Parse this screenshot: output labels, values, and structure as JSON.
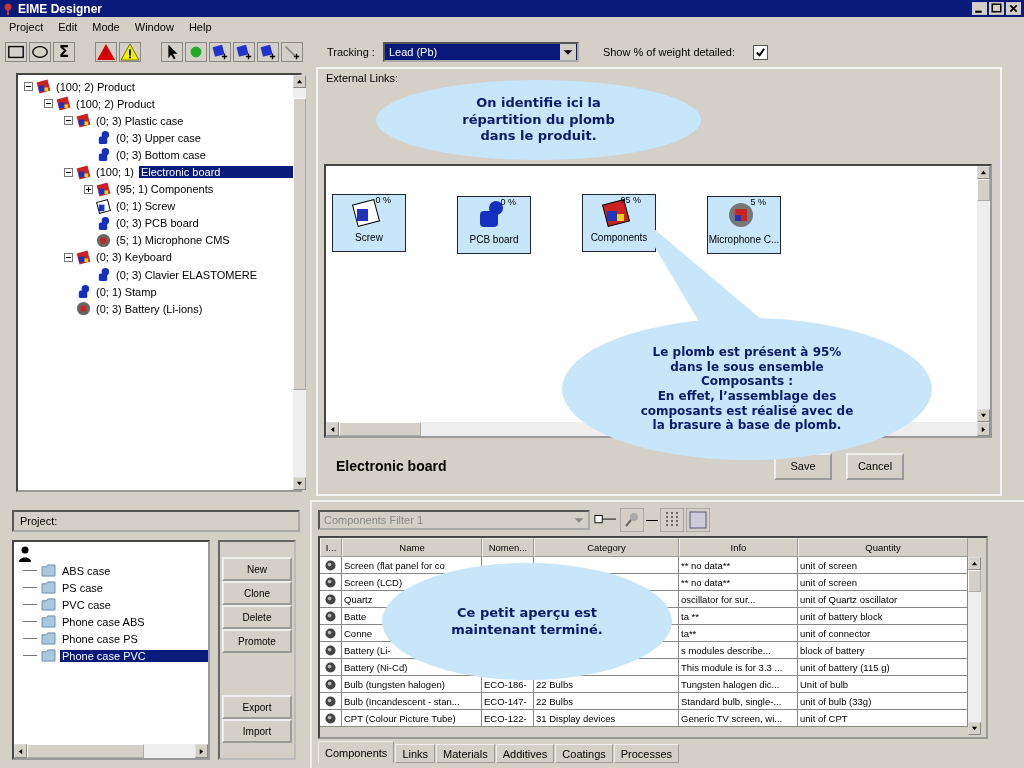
{
  "window": {
    "title": "EIME Designer"
  },
  "menu": [
    "Project",
    "Edit",
    "Mode",
    "Window",
    "Help"
  ],
  "toolbar": {
    "sigma": "Σ",
    "tracking_label": "Tracking :",
    "tracking_value": "Lead (Pb)",
    "show_weight_label": "Show % of weight detailed:",
    "show_weight_checked": true
  },
  "product_tree": [
    {
      "label": "(100; 2) Product",
      "kind": "assembly",
      "selected": false,
      "expanded": true,
      "children": [
        {
          "label": "(100; 2) Product",
          "kind": "assembly",
          "selected": false,
          "expanded": true,
          "children": [
            {
              "label": "(0; 3) Plastic case",
              "kind": "assembly",
              "selected": false,
              "expanded": true,
              "children": [
                {
                  "label": "(0; 3) Upper case",
                  "kind": "part",
                  "selected": false
                },
                {
                  "label": "(0; 3) Bottom case",
                  "kind": "part",
                  "selected": false
                }
              ]
            },
            {
              "label": "Electronic board",
              "prefix": "(100; 1)",
              "kind": "assembly",
              "selected": true,
              "expanded": true,
              "children": [
                {
                  "label": "(95; 1) Components",
                  "kind": "assembly",
                  "selected": false,
                  "expanded": false
                },
                {
                  "label": "(0; 1) Screw",
                  "kind": "screw",
                  "selected": false
                },
                {
                  "label": "(0; 3) PCB board",
                  "kind": "part",
                  "selected": false
                },
                {
                  "label": "(5; 1) Microphone CMS",
                  "kind": "component",
                  "selected": false
                }
              ]
            },
            {
              "label": "(0; 3) Keyboard",
              "kind": "assembly",
              "selected": false,
              "expanded": true,
              "children": [
                {
                  "label": "(0; 3) Clavier ELASTOMERE",
                  "kind": "part",
                  "selected": false
                }
              ]
            },
            {
              "label": "(0; 1) Stamp",
              "kind": "part",
              "selected": false
            },
            {
              "label": "(0; 3) Battery (Li-ions)",
              "kind": "component",
              "selected": false
            }
          ]
        }
      ]
    }
  ],
  "external_links": {
    "label": "External Links:"
  },
  "canvas_nodes": [
    {
      "label": "Screw",
      "percent": "0 %",
      "kind": "screw"
    },
    {
      "label": "PCB board",
      "percent": "0 %",
      "kind": "part"
    },
    {
      "label": "Components",
      "percent": "95 %",
      "kind": "assembly"
    },
    {
      "label": "Microphone C...",
      "percent": "5 %",
      "kind": "component"
    }
  ],
  "selected_name": "Electronic board",
  "dialog_buttons": [
    "Save",
    "Cancel"
  ],
  "project": {
    "label": "Project:",
    "items": [
      {
        "label": "ABS case",
        "selected": false
      },
      {
        "label": "PS case",
        "selected": false
      },
      {
        "label": "PVC case",
        "selected": false
      },
      {
        "label": "Phone case ABS",
        "selected": false
      },
      {
        "label": "Phone case PS",
        "selected": false
      },
      {
        "label": "Phone case PVC",
        "selected": true
      }
    ],
    "buttons": [
      "New",
      "Clone",
      "Delete",
      "Promote"
    ],
    "buttons_bottom": [
      "Export",
      "Import"
    ]
  },
  "filter": {
    "value": "Components Filter 1",
    "disabled": true
  },
  "table": {
    "columns": [
      "I...",
      "Name",
      "Nomen...",
      "Category",
      "Info",
      "Quantity"
    ],
    "rows": [
      {
        "name": "Screen (flat panel for co",
        "info": "** no data**",
        "quantity": "unit of screen"
      },
      {
        "name": "Screen (LCD)",
        "info": "** no data**",
        "quantity": "unit of screen"
      },
      {
        "name": "Quartz",
        "info": "oscillator for sur...",
        "quantity": "unit of Quartz  oscillator"
      },
      {
        "name": "Batte",
        "info": "ta **",
        "quantity": "unit of battery block"
      },
      {
        "name": "Conne",
        "info": "ta**",
        "quantity": "unit of connector"
      },
      {
        "name": "Battery (Li-",
        "info": "s modules describe...",
        "quantity": "block of battery"
      },
      {
        "name": "Battery (Ni-Cd)",
        "info": "This module is for 3.3 ...",
        "quantity": "unit of battery (115 g)"
      },
      {
        "name": "Bulb (tungsten halogen)",
        "nomen": "ECO-186-",
        "category": "22 Bulbs",
        "info": "Tungsten halogen dic...",
        "quantity": "Unit of bulb"
      },
      {
        "name": "Bulb (Incandescent - stan...",
        "nomen": "ECO-147-",
        "category": "22 Bulbs",
        "info": "Standard bulb, single-...",
        "quantity": "unit of bulb (33g)"
      },
      {
        "name": "CPT (Colour Picture Tube)",
        "nomen": "ECO-122-",
        "category": "31 Display devices",
        "info": "Generic TV screen, wi...",
        "quantity": "unit of CPT"
      }
    ]
  },
  "tabs": [
    {
      "label": "Components",
      "selected": true
    },
    {
      "label": "Links",
      "selected": false
    },
    {
      "label": "Materials",
      "selected": false
    },
    {
      "label": "Additives",
      "selected": false
    },
    {
      "label": "Coatings",
      "selected": false
    },
    {
      "label": "Processes",
      "selected": false
    }
  ],
  "callouts": [
    {
      "text": "On identifie ici la répartition du plomb dans le produit."
    },
    {
      "text": "Le plomb est présent à 95% dans le sous ensemble Composants :\nEn effet, l’assemblage des composants  est réalisé avec de la brasure à base de plomb."
    },
    {
      "text": "Ce petit aperçu est maintenant terminé."
    }
  ]
}
